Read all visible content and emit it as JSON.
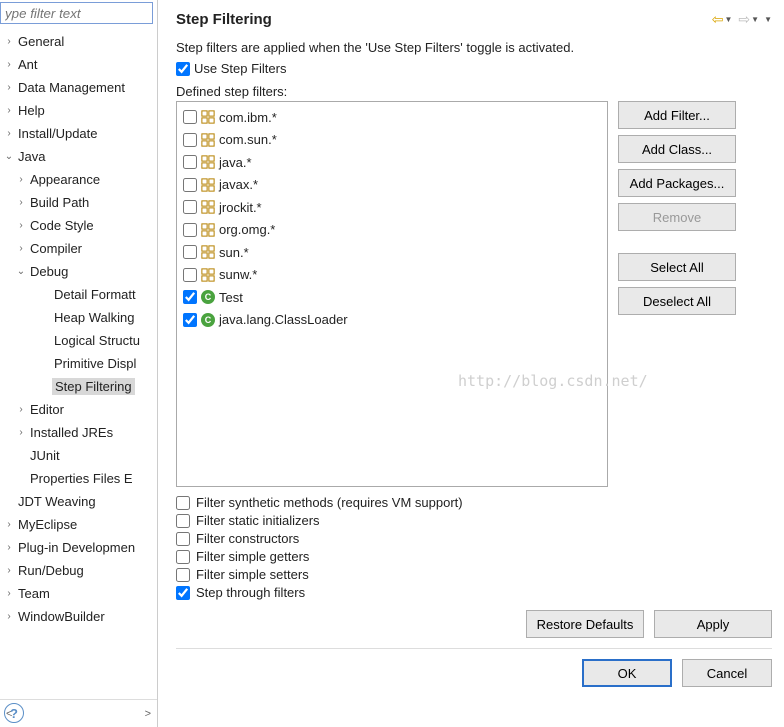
{
  "sidebar": {
    "filter_placeholder": "ype filter text",
    "items": [
      {
        "label": "General",
        "level": 0,
        "twisty": "›"
      },
      {
        "label": "Ant",
        "level": 0,
        "twisty": "›"
      },
      {
        "label": "Data Management",
        "level": 0,
        "twisty": "›"
      },
      {
        "label": "Help",
        "level": 0,
        "twisty": "›"
      },
      {
        "label": "Install/Update",
        "level": 0,
        "twisty": "›"
      },
      {
        "label": "Java",
        "level": 0,
        "twisty": "⌄"
      },
      {
        "label": "Appearance",
        "level": 1,
        "twisty": "›"
      },
      {
        "label": "Build Path",
        "level": 1,
        "twisty": "›"
      },
      {
        "label": "Code Style",
        "level": 1,
        "twisty": "›"
      },
      {
        "label": "Compiler",
        "level": 1,
        "twisty": "›"
      },
      {
        "label": "Debug",
        "level": 1,
        "twisty": "⌄"
      },
      {
        "label": "Detail Formatt",
        "level": 2,
        "twisty": ""
      },
      {
        "label": "Heap Walking",
        "level": 2,
        "twisty": ""
      },
      {
        "label": "Logical Structu",
        "level": 2,
        "twisty": ""
      },
      {
        "label": "Primitive Displ",
        "level": 2,
        "twisty": ""
      },
      {
        "label": "Step Filtering",
        "level": 2,
        "twisty": "",
        "selected": true
      },
      {
        "label": "Editor",
        "level": 1,
        "twisty": "›"
      },
      {
        "label": "Installed JREs",
        "level": 1,
        "twisty": "›"
      },
      {
        "label": "JUnit",
        "level": 1,
        "twisty": ""
      },
      {
        "label": "Properties Files E",
        "level": 1,
        "twisty": ""
      },
      {
        "label": "JDT Weaving",
        "level": 0,
        "twisty": ""
      },
      {
        "label": "MyEclipse",
        "level": 0,
        "twisty": "›"
      },
      {
        "label": "Plug-in Developmen",
        "level": 0,
        "twisty": "›"
      },
      {
        "label": "Run/Debug",
        "level": 0,
        "twisty": "›"
      },
      {
        "label": "Team",
        "level": 0,
        "twisty": "›"
      },
      {
        "label": "WindowBuilder",
        "level": 0,
        "twisty": "›"
      }
    ]
  },
  "main": {
    "title": "Step Filtering",
    "description": "Step filters are applied when the 'Use Step Filters' toggle is activated.",
    "use_step_filters_label": "Use Step Filters",
    "use_step_filters_checked": true,
    "defined_label": "Defined step filters:",
    "filters": [
      {
        "checked": false,
        "icon": "pkg",
        "label": "com.ibm.*"
      },
      {
        "checked": false,
        "icon": "pkg",
        "label": "com.sun.*"
      },
      {
        "checked": false,
        "icon": "pkg",
        "label": "java.*"
      },
      {
        "checked": false,
        "icon": "pkg",
        "label": "javax.*"
      },
      {
        "checked": false,
        "icon": "pkg",
        "label": "jrockit.*"
      },
      {
        "checked": false,
        "icon": "pkg",
        "label": "org.omg.*"
      },
      {
        "checked": false,
        "icon": "pkg",
        "label": "sun.*"
      },
      {
        "checked": false,
        "icon": "pkg",
        "label": "sunw.*"
      },
      {
        "checked": true,
        "icon": "class",
        "label": "Test"
      },
      {
        "checked": true,
        "icon": "class",
        "label": "java.lang.ClassLoader"
      }
    ],
    "buttons": {
      "add_filter": "Add Filter...",
      "add_class": "Add Class...",
      "add_packages": "Add Packages...",
      "remove": "Remove",
      "select_all": "Select All",
      "deselect_all": "Deselect All"
    },
    "options": [
      {
        "checked": false,
        "label": "Filter synthetic methods (requires VM support)"
      },
      {
        "checked": false,
        "label": "Filter static initializers"
      },
      {
        "checked": false,
        "label": "Filter constructors"
      },
      {
        "checked": false,
        "label": "Filter simple getters"
      },
      {
        "checked": false,
        "label": "Filter simple setters"
      },
      {
        "checked": true,
        "label": "Step through filters"
      }
    ],
    "restore_defaults": "Restore Defaults",
    "apply": "Apply",
    "ok": "OK",
    "cancel": "Cancel",
    "watermark": "http://blog.csdn.net/"
  }
}
